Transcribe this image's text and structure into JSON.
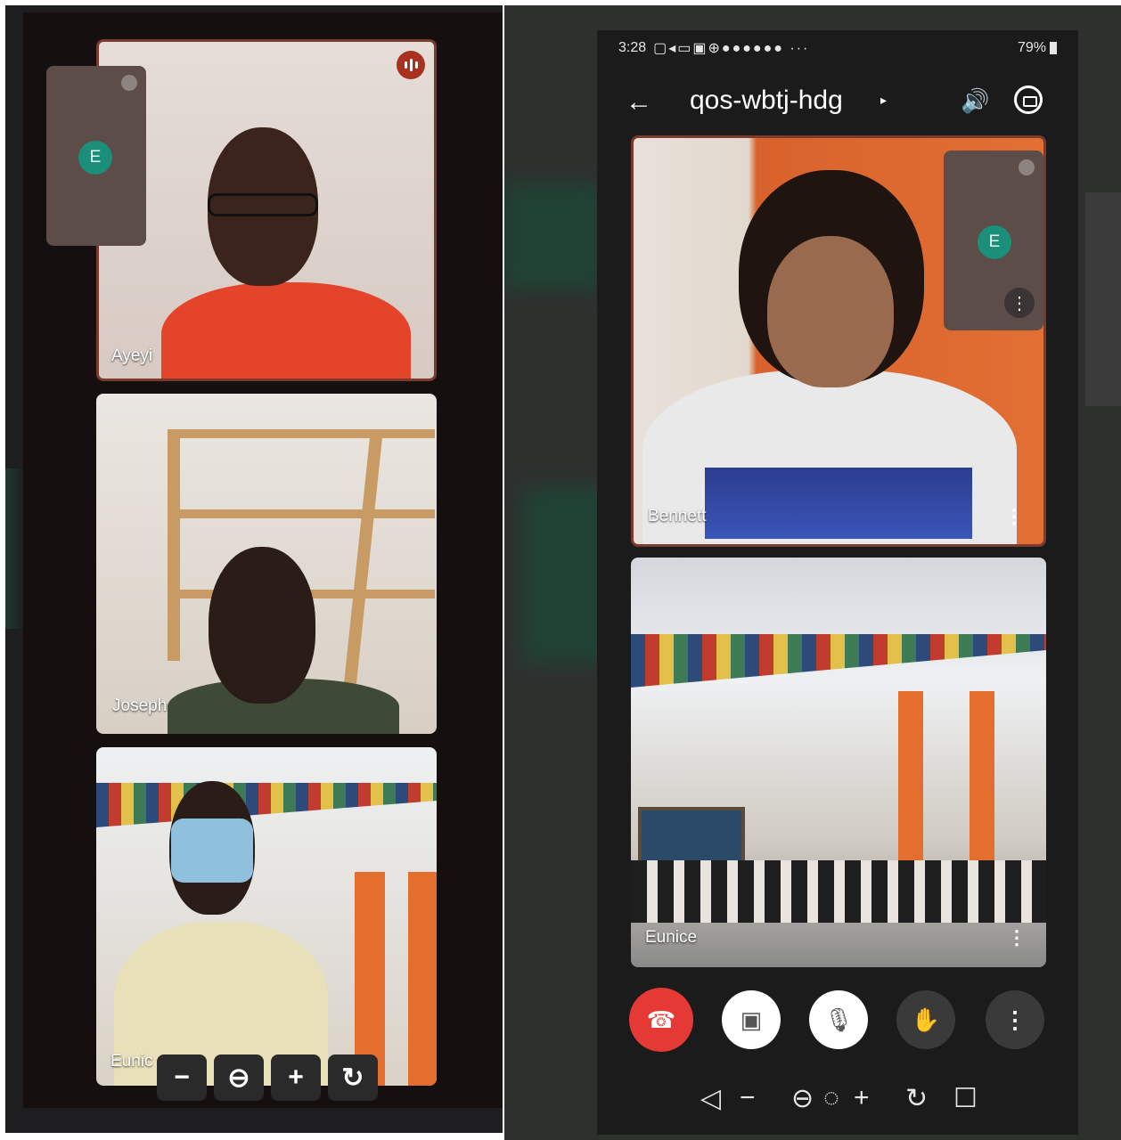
{
  "left_call": {
    "tiles": [
      {
        "name": "Ayeyi"
      },
      {
        "name": "Joseph"
      },
      {
        "name": "Eunic"
      }
    ],
    "self_view": {
      "avatar_initial": "E"
    },
    "zoom_controls": {
      "minus": "−",
      "zoom_out": "⊖",
      "plus": "+",
      "reset": "↻"
    }
  },
  "right_call": {
    "status_bar": {
      "time": "3:28",
      "battery": "79%"
    },
    "header": {
      "back": "←",
      "meeting_code": "qos-wbtj-hdg",
      "caret": "▸",
      "speaker": "🔊"
    },
    "tiles": [
      {
        "name": "Bennett"
      },
      {
        "name": "Eunice"
      }
    ],
    "self_view": {
      "avatar_initial": "E"
    },
    "controls": {
      "end_call": "☎",
      "camera_off": "▣",
      "mic_off": "🎙",
      "raise_hand": "✋",
      "more": "⋮"
    },
    "nav_bar": {
      "back": "◁",
      "minus": "−",
      "zoom_out": "⊖",
      "circle": "◌",
      "plus": "+",
      "reset": "↻",
      "square": "☐"
    }
  },
  "colors": {
    "end_call_red": "#e53935",
    "avatar_teal": "#1c8f7a",
    "active_speaker_border": "#7a3a2e"
  }
}
